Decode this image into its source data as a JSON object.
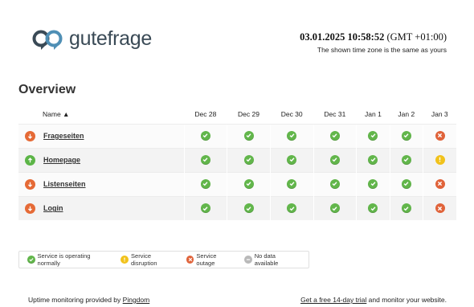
{
  "header": {
    "logo_text": "gutefrage",
    "datetime": "03.01.2025 10:58:52",
    "timezone": "(GMT +01:00)",
    "timezone_note": "The shown time zone is the same as yours"
  },
  "overview": {
    "title": "Overview",
    "name_header": "Name ▲",
    "dates": [
      "Dec 28",
      "Dec 29",
      "Dec 30",
      "Dec 31",
      "Jan 1",
      "Jan 2",
      "Jan 3"
    ],
    "rows": [
      {
        "name": "Frageseiten",
        "direction": "down",
        "statuses": [
          "ok",
          "ok",
          "ok",
          "ok",
          "ok",
          "ok",
          "outage"
        ]
      },
      {
        "name": "Homepage",
        "direction": "up",
        "statuses": [
          "ok",
          "ok",
          "ok",
          "ok",
          "ok",
          "ok",
          "disruption"
        ]
      },
      {
        "name": "Listenseiten",
        "direction": "down",
        "statuses": [
          "ok",
          "ok",
          "ok",
          "ok",
          "ok",
          "ok",
          "outage"
        ]
      },
      {
        "name": "Login",
        "direction": "down",
        "statuses": [
          "ok",
          "ok",
          "ok",
          "ok",
          "ok",
          "ok",
          "outage"
        ]
      }
    ]
  },
  "legend": {
    "ok": "Service is operating normally",
    "disruption": "Service disruption",
    "outage": "Service outage",
    "nodata": "No data available"
  },
  "footer": {
    "left_prefix": "Uptime monitoring provided by",
    "left_link": "Pingdom",
    "right_link": "Get a free 14-day trial",
    "right_suffix": "and monitor your website."
  },
  "colors": {
    "ok": "#62b64b",
    "disruption": "#f1c21b",
    "outage": "#e0633a",
    "nodata": "#b9b9b9",
    "brand": "#3a4a56",
    "logo_accent": "#4f8fb5"
  },
  "icons": {
    "ok": "check-circle-icon",
    "disruption": "exclamation-circle-icon",
    "outage": "x-circle-icon",
    "nodata": "dash-circle-icon",
    "up": "arrow-up-icon",
    "down": "arrow-down-icon"
  }
}
